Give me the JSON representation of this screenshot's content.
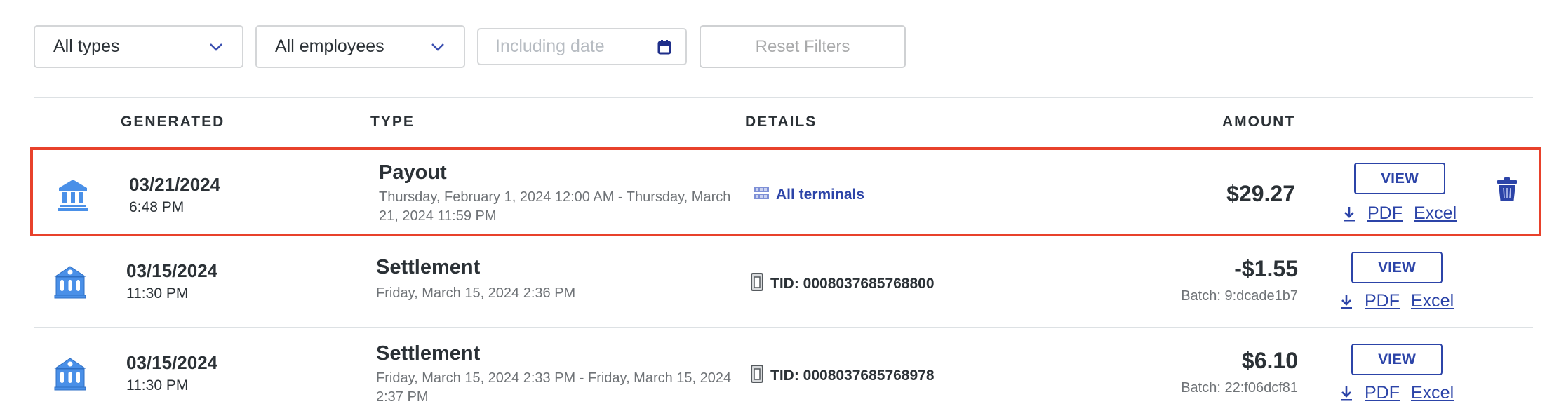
{
  "filters": {
    "type_select": {
      "value": "All types",
      "icon": "chevron-down-icon"
    },
    "employee_select": {
      "value": "All employees",
      "icon": "chevron-down-icon"
    },
    "date_input": {
      "value": "",
      "placeholder": "Including date",
      "icon": "calendar-icon"
    },
    "reset_label": "Reset Filters"
  },
  "table": {
    "columns": [
      "GENERATED",
      "TYPE",
      "DETAILS",
      "AMOUNT"
    ],
    "rows": [
      {
        "selected": true,
        "icon": "bank-icon",
        "date": "03/21/2024",
        "time": "6:48 PM",
        "type": "Payout",
        "type_detail": "Thursday, February 1, 2024 12:00 AM - Thursday, March 21, 2024 11:59 PM",
        "details_icon": "terminals-grid-icon",
        "details": "All terminals",
        "amount": "$29.27",
        "batch": "",
        "view_label": "VIEW",
        "pdf_label": "PDF",
        "excel_label": "Excel",
        "has_delete": true
      },
      {
        "selected": false,
        "icon": "bank-icon",
        "date": "03/15/2024",
        "time": "11:30 PM",
        "type": "Settlement",
        "type_detail": "Friday, March 15, 2024 2:36 PM",
        "details_icon": "terminal-device-icon",
        "details": "TID: 0008037685768800",
        "amount": "-$1.55",
        "batch": "Batch: 9:dcade1b7",
        "view_label": "VIEW",
        "pdf_label": "PDF",
        "excel_label": "Excel",
        "has_delete": false
      },
      {
        "selected": false,
        "icon": "bank-icon",
        "date": "03/15/2024",
        "time": "11:30 PM",
        "type": "Settlement",
        "type_detail": "Friday, March 15, 2024 2:33 PM - Friday, March 15, 2024 2:37 PM",
        "details_icon": "terminal-device-icon",
        "details": "TID: 0008037685768978",
        "amount": "$6.10",
        "batch": "Batch: 22:f06dcf81",
        "view_label": "VIEW",
        "pdf_label": "PDF",
        "excel_label": "Excel",
        "has_delete": false
      }
    ]
  },
  "colors": {
    "accent": "#2c44a8",
    "bank_icon": "#4a90e8",
    "highlight_border": "#e8412b"
  }
}
